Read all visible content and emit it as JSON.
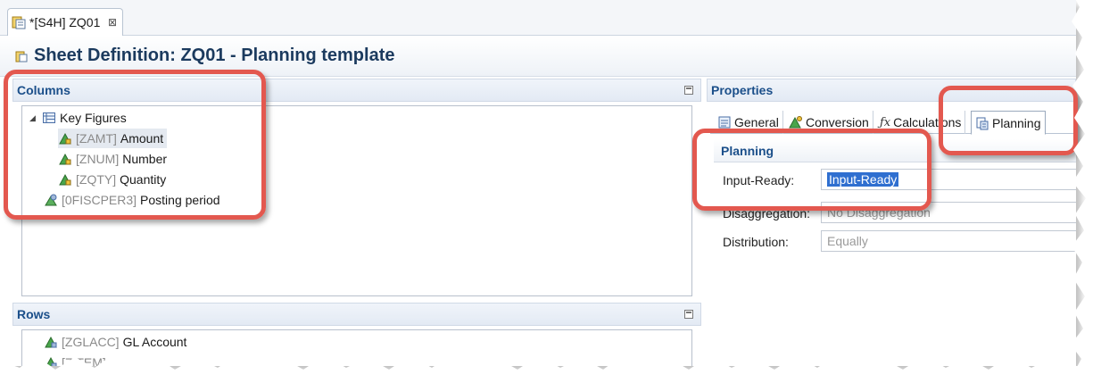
{
  "editor_tab": {
    "label": "*[S4H] ZQ01",
    "close": "⊠"
  },
  "title": "Sheet Definition: ZQ01 - Planning template",
  "columns": {
    "title": "Columns",
    "root": "Key Figures",
    "items": [
      {
        "tech": "[ZAMT]",
        "name": "Amount"
      },
      {
        "tech": "[ZNUM]",
        "name": "Number"
      },
      {
        "tech": "[ZQTY]",
        "name": "Quantity"
      }
    ],
    "extra": {
      "tech": "[0FISCPER3]",
      "name": "Posting period"
    }
  },
  "rows": {
    "title": "Rows",
    "items": [
      {
        "tech": "[ZGLACC]",
        "name": "GL Account"
      },
      {
        "tech": "[ZITEM]",
        "name": "Ite"
      }
    ]
  },
  "properties": {
    "title": "Properties",
    "tabs": [
      "General",
      "Conversion",
      "Calculations",
      "Planning"
    ],
    "section_title": "Planning",
    "fields": [
      {
        "label": "Input-Ready:",
        "value": "Input-Ready"
      },
      {
        "label": "Disaggregation:",
        "value": "No Disaggregation"
      },
      {
        "label": "Distribution:",
        "value": "Equally"
      }
    ]
  },
  "colors": {
    "accent": "#1b4f8a",
    "annotation": "#e3584f",
    "selection": "#2f6fd0"
  }
}
